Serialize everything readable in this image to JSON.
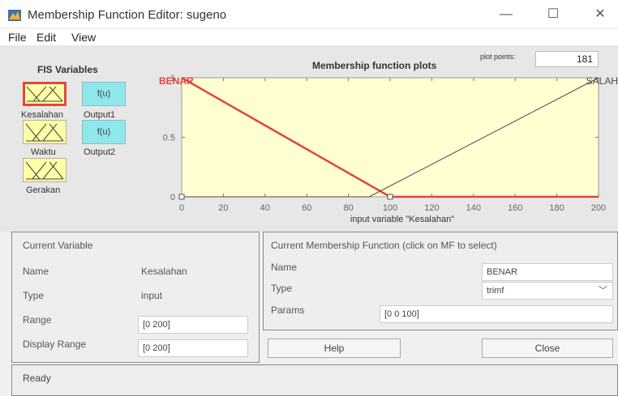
{
  "window": {
    "title": "Membership Function Editor: sugeno",
    "minimize": "—",
    "maximize": "☐",
    "close": "✕"
  },
  "menu": [
    "File",
    "Edit",
    "View"
  ],
  "fis": {
    "title": "FIS Variables",
    "inputs": [
      {
        "name": "Kesalahan",
        "selected": true
      },
      {
        "name": "Waktu",
        "selected": false
      },
      {
        "name": "Gerakan",
        "selected": false
      }
    ],
    "outputs": [
      {
        "name": "Output1",
        "label": "f(u)"
      },
      {
        "name": "Output2",
        "label": "f(u)"
      }
    ]
  },
  "plot": {
    "title": "Membership function plots",
    "plot_points_label": "plot points:",
    "plot_points_value": "181",
    "xlabel": "input variable \"Kesalahan\"",
    "colors": {
      "selected": "#e0473f",
      "other": "#4a4a4a",
      "bg": "#ffffd2"
    }
  },
  "chart_data": {
    "type": "line",
    "xlabel": "input variable \"Kesalahan\"",
    "xlim": [
      0,
      200
    ],
    "ylim": [
      0,
      1
    ],
    "xticks": [
      "0",
      "20",
      "40",
      "60",
      "80",
      "100",
      "120",
      "140",
      "160",
      "180",
      "200"
    ],
    "yticks": [
      "0",
      "0.5",
      "1"
    ],
    "series": [
      {
        "name": "BENAR",
        "type": "trimf",
        "params": [
          0,
          0,
          100
        ],
        "selected": true,
        "x": [
          0,
          100,
          200
        ],
        "y": [
          1,
          0,
          0
        ]
      },
      {
        "name": "SALAH",
        "type": "trimf",
        "params": [
          90,
          200,
          200
        ],
        "selected": false,
        "x": [
          0,
          90,
          200
        ],
        "y": [
          0,
          0,
          1
        ]
      }
    ]
  },
  "current_variable": {
    "heading": "Current Variable",
    "name_label": "Name",
    "name_value": "Kesalahan",
    "type_label": "Type",
    "type_value": "input",
    "range_label": "Range",
    "range_value": "[0 200]",
    "display_range_label": "Display Range",
    "display_range_value": "[0 200]"
  },
  "current_mf": {
    "heading": "Current Membership Function (click on MF to select)",
    "name_label": "Name",
    "name_value": "BENAR",
    "type_label": "Type",
    "type_value": "trimf",
    "params_label": "Params",
    "params_value": "[0 0 100]"
  },
  "buttons": {
    "help": "Help",
    "close": "Close"
  },
  "status": "Ready"
}
